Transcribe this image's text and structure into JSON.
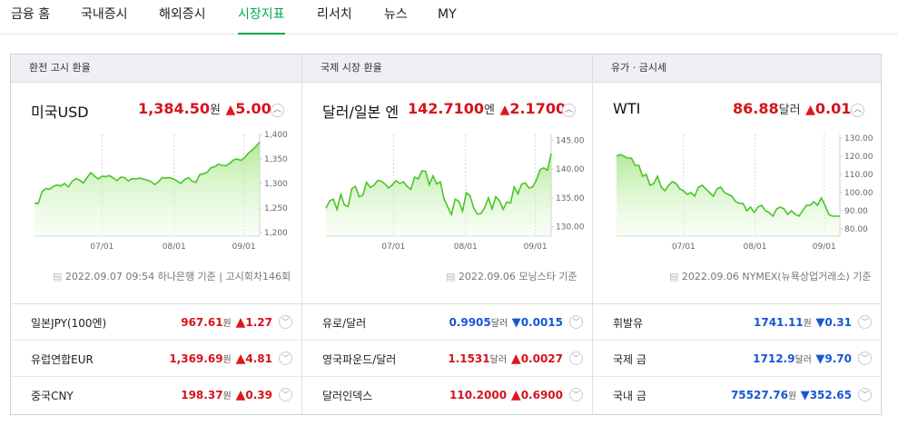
{
  "nav": {
    "items": [
      "금융 홈",
      "국내증시",
      "해외증시",
      "시장지표",
      "리서치",
      "뉴스",
      "MY"
    ],
    "active": "시장지표"
  },
  "panels": [
    {
      "header": "환전 고시 환율",
      "name": "미국USD",
      "value": "1,384.50",
      "unit": "원",
      "change_arrow": "▲",
      "change": "5.00",
      "source": "2022.09.07 09:54 하나은행 기준 | 고시회차146회",
      "chart_data": {
        "type": "area",
        "x_ticks": [
          "07/01",
          "08/01",
          "09/01"
        ],
        "y_ticks": [
          "1,400",
          "1,350",
          "1,300",
          "1,250",
          "1,200"
        ],
        "ylim": [
          1200,
          1400
        ],
        "values": [
          1260,
          1259,
          1283,
          1290,
          1288,
          1294,
          1297,
          1295,
          1300,
          1293,
          1304,
          1310,
          1307,
          1301,
          1312,
          1322,
          1315,
          1309,
          1315,
          1314,
          1316,
          1311,
          1306,
          1313,
          1312,
          1305,
          1310,
          1309,
          1311,
          1309,
          1307,
          1304,
          1298,
          1303,
          1312,
          1311,
          1312,
          1309,
          1305,
          1300,
          1308,
          1312,
          1305,
          1302,
          1318,
          1320,
          1323,
          1332,
          1334,
          1339,
          1337,
          1336,
          1341,
          1348,
          1350,
          1347,
          1353,
          1362,
          1368,
          1376,
          1384
        ]
      },
      "list": [
        {
          "name": "일본JPY(100엔)",
          "value": "967.61",
          "unit": "원",
          "arrow": "▲",
          "change": "1.27",
          "dir": "up"
        },
        {
          "name": "유럽연합EUR",
          "value": "1,369.69",
          "unit": "원",
          "arrow": "▲",
          "change": "4.81",
          "dir": "up"
        },
        {
          "name": "중국CNY",
          "value": "198.37",
          "unit": "원",
          "arrow": "▲",
          "change": "0.39",
          "dir": "up"
        }
      ]
    },
    {
      "header": "국제 시장 환율",
      "name": "달러/일본 엔",
      "value": "142.7100",
      "unit": "엔",
      "change_arrow": "▲",
      "change": "2.1700",
      "source": "2022.09.06 모닝스타 기준",
      "chart_data": {
        "type": "area",
        "x_ticks": [
          "07/01",
          "08/01",
          "09/01"
        ],
        "y_ticks": [
          "145.00",
          "140.00",
          "135.00",
          "130.00"
        ],
        "ylim": [
          129,
          146
        ],
        "values": [
          133.2,
          134.5,
          134.8,
          133.0,
          135.6,
          133.8,
          133.5,
          136.6,
          137.0,
          135.2,
          135.5,
          137.7,
          136.8,
          137.2,
          138.0,
          137.9,
          137.4,
          136.7,
          137.3,
          138.0,
          137.5,
          137.8,
          137.0,
          136.5,
          138.6,
          138.3,
          139.7,
          139.6,
          137.3,
          138.8,
          137.4,
          137.8,
          134.8,
          133.4,
          132.1,
          134.8,
          134.4,
          132.7,
          135.9,
          135.4,
          133.3,
          132.2,
          132.3,
          133.3,
          135.0,
          133.1,
          135.2,
          134.5,
          133.0,
          134.3,
          134.1,
          136.9,
          135.7,
          137.4,
          137.6,
          136.7,
          136.9,
          138.1,
          139.9,
          140.2,
          139.8,
          142.7
        ]
      },
      "list": [
        {
          "name": "유로/달러",
          "value": "0.9905",
          "unit": "달러",
          "arrow": "▼",
          "change": "0.0015",
          "dir": "down"
        },
        {
          "name": "영국파운드/달러",
          "value": "1.1531",
          "unit": "달러",
          "arrow": "▲",
          "change": "0.0027",
          "dir": "up"
        },
        {
          "name": "달러인덱스",
          "value": "110.2000",
          "unit": "",
          "arrow": "▲",
          "change": "0.6900",
          "dir": "up"
        }
      ]
    },
    {
      "header": "유가 · 금시세",
      "name": "WTI",
      "value": "86.88",
      "unit": "달러",
      "change_arrow": "▲",
      "change": "0.01",
      "source": "2022.09.06 NYMEX(뉴욕상업거래소) 기준",
      "chart_data": {
        "type": "area",
        "x_ticks": [
          "07/01",
          "08/01",
          "09/01"
        ],
        "y_ticks": [
          "130.00",
          "120.00",
          "110.00",
          "100.00",
          "90.00",
          "80.00"
        ],
        "ylim": [
          78,
          132
        ],
        "values": [
          120,
          121,
          120,
          119,
          119,
          115,
          115,
          109,
          110,
          104,
          105,
          109,
          103,
          101,
          104,
          106,
          105,
          102,
          101,
          99,
          100,
          98,
          103,
          104,
          102,
          100,
          98,
          102,
          103,
          100,
          99,
          98,
          95,
          94,
          94,
          90,
          92,
          89,
          92,
          93,
          90,
          89,
          87,
          91,
          92,
          91,
          88,
          90,
          88,
          87,
          90,
          93,
          93,
          95,
          93,
          97,
          93,
          88,
          87,
          87,
          87
        ]
      },
      "list": [
        {
          "name": "휘발유",
          "value": "1741.11",
          "unit": "원",
          "arrow": "▼",
          "change": "0.31",
          "dir": "down"
        },
        {
          "name": "국제 금",
          "value": "1712.9",
          "unit": "달러",
          "arrow": "▼",
          "change": "9.70",
          "dir": "down"
        },
        {
          "name": "국내 금",
          "value": "75527.76",
          "unit": "원",
          "arrow": "▼",
          "change": "352.65",
          "dir": "down"
        }
      ]
    }
  ]
}
